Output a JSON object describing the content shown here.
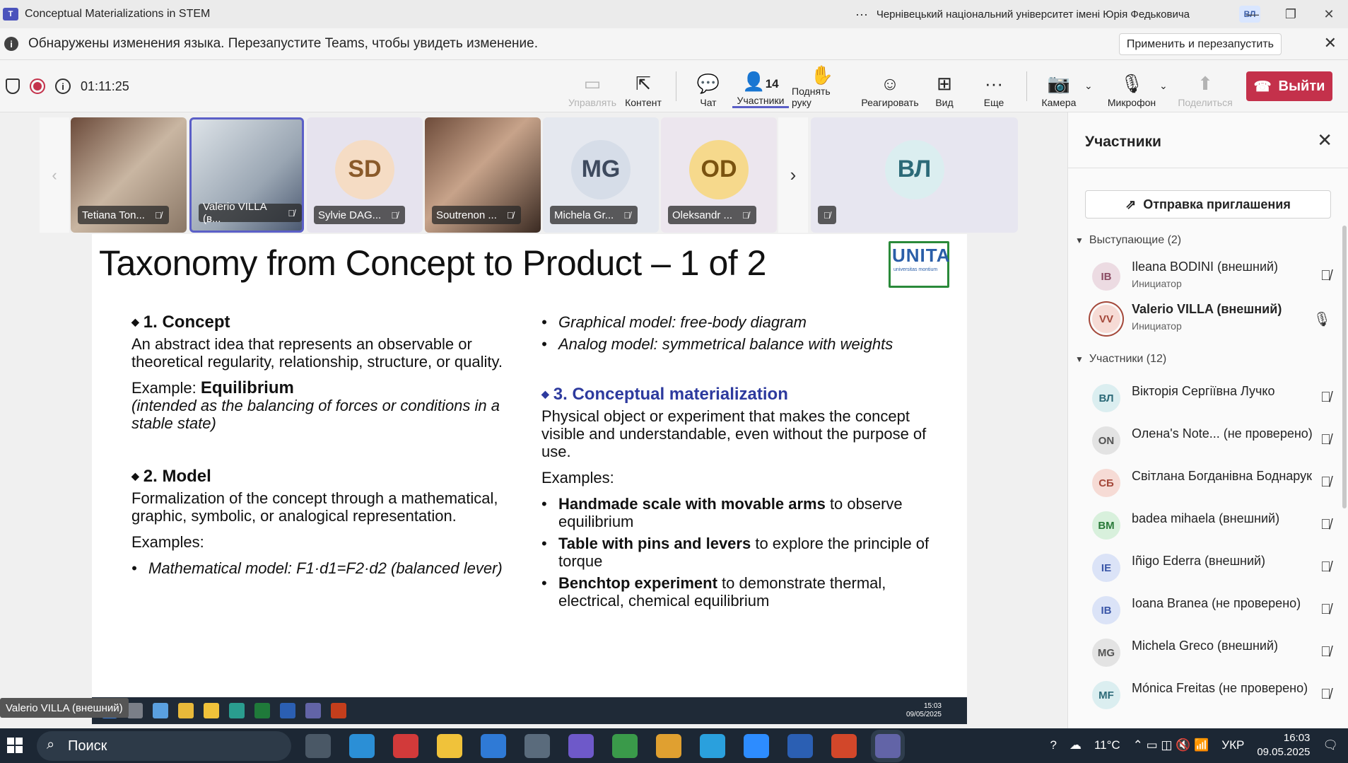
{
  "window": {
    "title": "Conceptual Materializations in STEM",
    "org": "Чернівецький національний університет імені Юрія Федьковича",
    "user_initials": "ВЛ",
    "more": "···",
    "minimize": "—",
    "maximize": "❐",
    "close": "✕"
  },
  "notice": {
    "text": "Обнаружены изменения языка. Перезапустите Teams, чтобы увидеть изменение.",
    "apply_label": "Применить и перезапустить",
    "close": "✕",
    "info": "i"
  },
  "toolbar": {
    "timer": "01:11:25",
    "buttons": [
      {
        "label": "Управлять",
        "icon": "▭"
      },
      {
        "label": "Контент",
        "icon": "⇱"
      },
      {
        "label": "Чат",
        "icon": "💬"
      },
      {
        "label": "Участники",
        "icon": "👤",
        "count": "14"
      },
      {
        "label": "Поднять руку",
        "icon": "✋"
      },
      {
        "label": "Реагировать",
        "icon": "☺"
      },
      {
        "label": "Вид",
        "icon": "⊞"
      },
      {
        "label": "Еще",
        "icon": "···"
      },
      {
        "label": "Камера",
        "icon": "📷"
      },
      {
        "label": "Микрофон",
        "icon": "🎙"
      },
      {
        "label": "Поделиться",
        "icon": "⬆"
      }
    ],
    "leave_label": "Выйти",
    "leave_icon": "☎"
  },
  "tiles": [
    {
      "name": "Tetiana Ton..."
    },
    {
      "name": "Valerio VILLA (в..."
    },
    {
      "name": "Sylvie DAG...",
      "initials": "SD"
    },
    {
      "name": "Soutrenon ..."
    },
    {
      "name": "Michela Gr...",
      "initials": "MG"
    },
    {
      "name": "Oleksandr ...",
      "initials": "OD"
    },
    {
      "initials": "ВЛ"
    }
  ],
  "slide": {
    "title": "Taxonomy from Concept to Product – 1 of 2",
    "logo": "UNITA",
    "logo_sub": "universitas montium",
    "concept_heading": "1. Concept",
    "concept_text": "An abstract idea that represents an observable or theoretical regularity, relationship, structure, or quality.",
    "concept_example_prefix": "Example: ",
    "concept_example": "Equilibrium",
    "concept_example_note": "(intended as the balancing of forces or conditions in a stable state)",
    "model_heading": "2. Model",
    "model_text": "Formalization of the concept through a mathematical, graphic, symbolic, or analogical representation.",
    "model_examples_label": "Examples:",
    "model_example_1": "Mathematical model: F1·d1=F2·d2 (balanced lever)",
    "right_bullet_1": "Graphical model: free-body diagram",
    "right_bullet_2": "Analog model: symmetrical balance with weights",
    "cm_heading": "3. Conceptual materialization",
    "cm_text": "Physical object or experiment that makes the concept visible and understandable, even without the purpose of use.",
    "cm_examples_label": "Examples:",
    "cm_ex1_bold": "Handmade scale with movable arms",
    "cm_ex1_rest": " to observe equilibrium",
    "cm_ex2_bold": "Table with pins and levers",
    "cm_ex2_rest": " to explore the principle of torque",
    "cm_ex3_bold": "Benchtop experiment",
    "cm_ex3_rest": " to demonstrate thermal, electrical, chemical equilibrium"
  },
  "shared_taskbar": {
    "time": "15:03",
    "date": "09/05/2025"
  },
  "speaker_tag": "Valerio VILLA (внешний)",
  "panel": {
    "title": "Участники",
    "invite_label": "Отправка приглашения",
    "presenters_label": "Выступающие (2)",
    "attendees_label": "Участники (12)",
    "presenters": [
      {
        "initials": "IB",
        "name": "Ileana BODINI (внешний)",
        "role": "Инициатор"
      },
      {
        "initials": "VV",
        "name": "Valerio VILLA (внешний)",
        "role": "Инициатор"
      }
    ],
    "attendees": [
      {
        "initials": "ВЛ",
        "name": "Вікторія Сергіївна Лучко"
      },
      {
        "initials": "ON",
        "name": "Олена's Note... (не проверено)"
      },
      {
        "initials": "СБ",
        "name": "Світлана Богданівна Боднарук"
      },
      {
        "initials": "BM",
        "name": "badea mihaela (внешний)"
      },
      {
        "initials": "IE",
        "name": "Iñigo Ederra (внешний)"
      },
      {
        "initials": "IB",
        "name": "Ioana Branea (не проверено)"
      },
      {
        "initials": "MG",
        "name": "Michela Greco (внешний)"
      },
      {
        "initials": "MF",
        "name": "Mónica Freitas (не проверено)"
      }
    ]
  },
  "winbar": {
    "search_label": "Поиск",
    "weather": "11°C",
    "lang": "УКР",
    "time": "16:03",
    "date": "09.05.2025"
  }
}
